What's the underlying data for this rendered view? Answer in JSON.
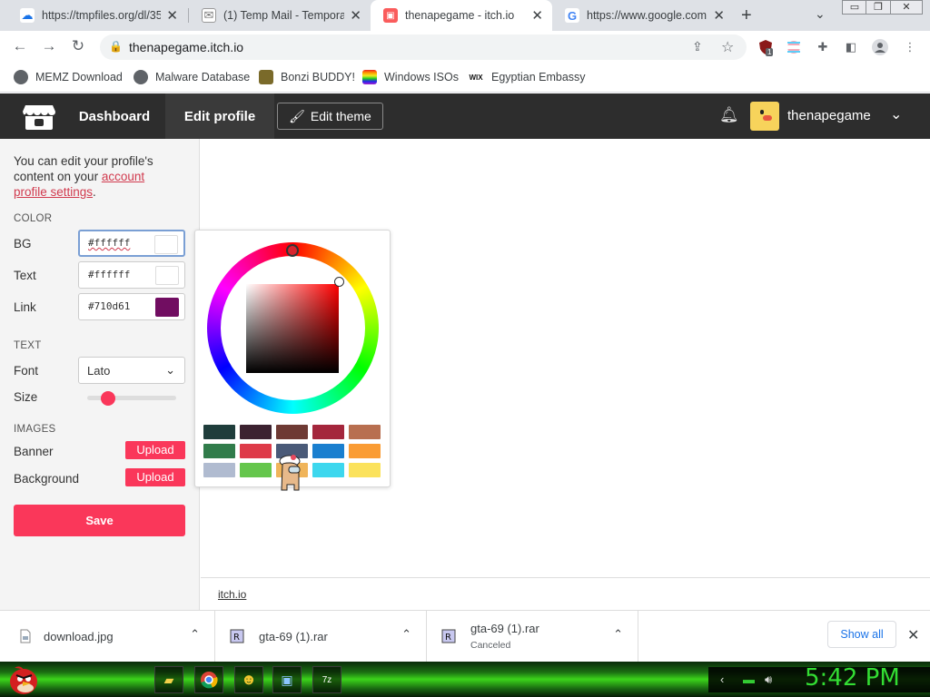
{
  "tabs": [
    {
      "title": "https://tmpfiles.org/dl/35",
      "favicon": "tmpfiles-icon",
      "active": false
    },
    {
      "title": "(1) Temp Mail - Temporar",
      "favicon": "gmail-style-icon",
      "active": false
    },
    {
      "title": "thenapegame - itch.io",
      "favicon": "itchio-icon",
      "active": true
    },
    {
      "title": "https://www.google.com",
      "favicon": "google-icon",
      "active": false
    }
  ],
  "window_controls": {
    "minimize": "▭",
    "restore": "❐",
    "close": "✕"
  },
  "toolbar": {
    "url": "thenapegame.itch.io",
    "back": "←",
    "forward": "→",
    "reload": "↻",
    "extension_badge": "1"
  },
  "bookmarks": [
    {
      "label": "MEMZ Download",
      "icon": "globe-icon"
    },
    {
      "label": "Malware Database",
      "icon": "globe-icon"
    },
    {
      "label": "Bonzi BUDDY!",
      "icon": "bonzi-icon"
    },
    {
      "label": "Windows ISOs",
      "icon": "windows-flag-icon"
    },
    {
      "label": "Egyptian Embassy",
      "icon": "wix-icon"
    }
  ],
  "itch_header": {
    "dashboard": "Dashboard",
    "edit_profile": "Edit profile",
    "edit_theme": "Edit theme",
    "username": "thenapegame"
  },
  "sidebar": {
    "intro_before": "You can edit your profile's content on your ",
    "intro_link": "account profile settings",
    "intro_after": ".",
    "color_section": "COLOR",
    "colors": [
      {
        "label": "BG",
        "value": "#ffffff",
        "swatch": "#ffffff"
      },
      {
        "label": "Text",
        "value": "#ffffff",
        "swatch": "#ffffff"
      },
      {
        "label": "Link",
        "value": "#710d61",
        "swatch": "#710d61"
      }
    ],
    "text_section": "TEXT",
    "font_label": "Font",
    "font_value": "Lato",
    "size_label": "Size",
    "size_slider_fraction": 0.2,
    "images_section": "IMAGES",
    "banner_label": "Banner",
    "background_label": "Background",
    "upload_label": "Upload",
    "save_label": "Save"
  },
  "picker": {
    "palette": [
      [
        "#1f3d3b",
        "#3c2230",
        "#6e3a34",
        "#a4263c",
        "#b86f50"
      ],
      [
        "#317c4b",
        "#de3b49",
        "#4a5a78",
        "#1a7fcf",
        "#fa9c34"
      ],
      [
        "#b0bbd0",
        "#65c64c",
        "#f0b45a",
        "#3dd7ee",
        "#fbe25c"
      ]
    ]
  },
  "footer": {
    "link": "itch.io"
  },
  "downloads": [
    {
      "name": "download.jpg",
      "status": ""
    },
    {
      "name": "gta-69 (1).rar",
      "status": ""
    },
    {
      "name": "gta-69 (1).rar",
      "status": "Canceled"
    }
  ],
  "downloads_bar": {
    "show_all": "Show all"
  },
  "taskbar": {
    "clock": "5:42 PM"
  }
}
